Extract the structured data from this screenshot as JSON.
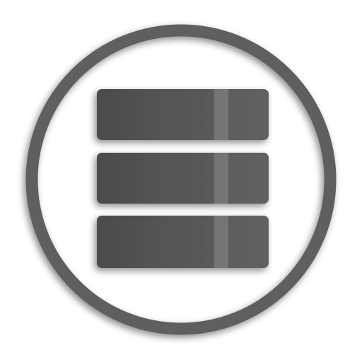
{
  "icon": {
    "name": "database-stack-icon",
    "description_label": "",
    "colors": {
      "ring": "#5e5e5e",
      "bar_left": "#4d4d4d",
      "bar_right": "#606060",
      "highlight_stripe": "#767676",
      "background": "#ffffff"
    },
    "bar_count": 3
  }
}
